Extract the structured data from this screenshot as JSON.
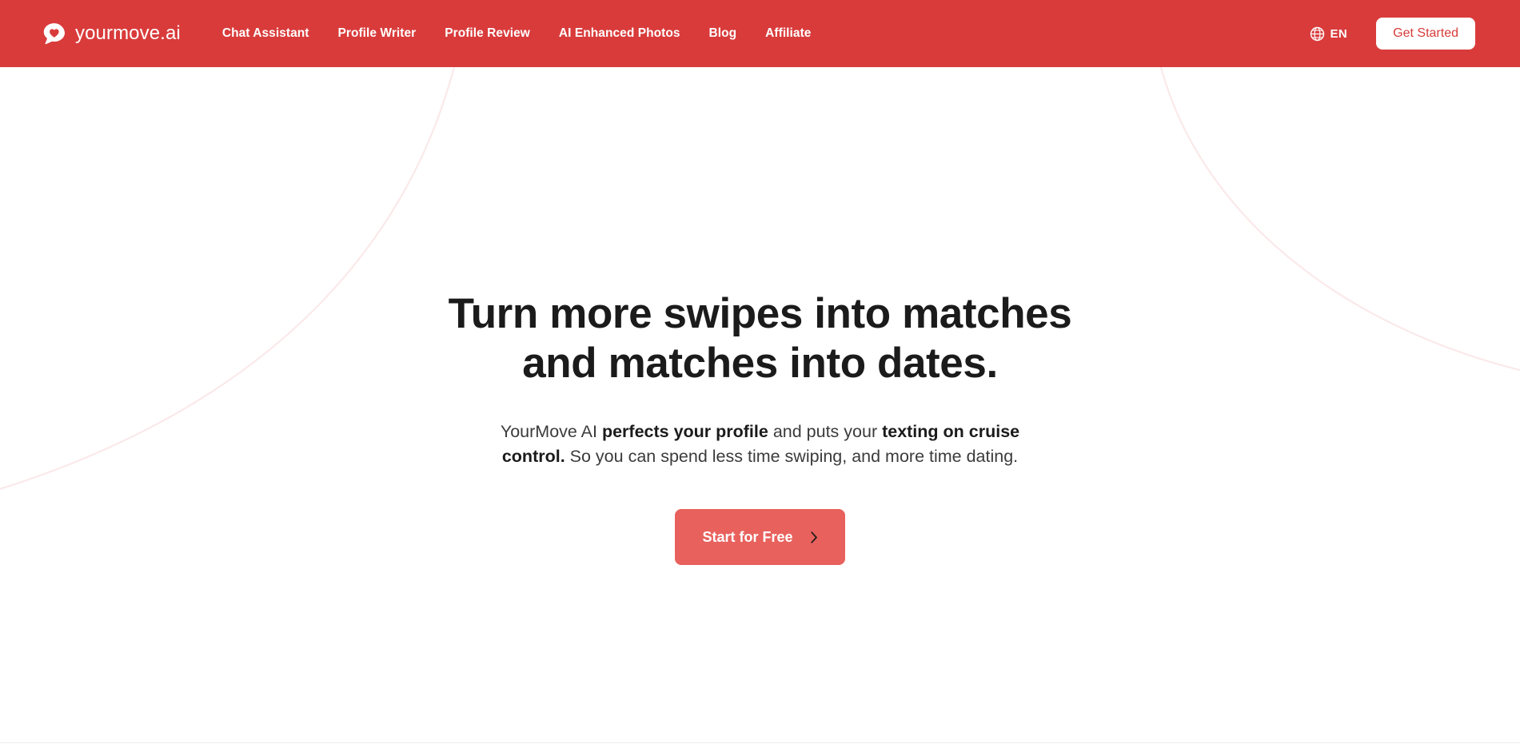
{
  "brand": {
    "name": "yourmove.ai",
    "logo_icon": "speech-bubble-heart-icon"
  },
  "colors": {
    "header_red": "#D93B3B",
    "cta_coral": "#E8615D",
    "button_text_red": "#D93B3B",
    "heading_black": "#1B1B1B",
    "body_gray": "#3B3B3B",
    "arc_pink": "#FBE9EA"
  },
  "nav": {
    "items": [
      {
        "label": "Chat Assistant"
      },
      {
        "label": "Profile Writer"
      },
      {
        "label": "Profile Review"
      },
      {
        "label": "AI Enhanced Photos"
      },
      {
        "label": "Blog"
      },
      {
        "label": "Affiliate"
      }
    ]
  },
  "header_actions": {
    "language": {
      "icon": "globe-icon",
      "code": "EN"
    },
    "get_started_label": "Get Started"
  },
  "hero": {
    "title_line_1": "Turn more swipes into matches",
    "title_line_2": "and matches into dates.",
    "subtitle": {
      "part_1": "YourMove AI ",
      "bold_1": "perfects your profile",
      "part_2": " and puts your ",
      "bold_2": "texting on cruise control.",
      "part_3": " So you can spend less time swiping, and more time dating."
    },
    "cta_label": "Start for Free",
    "cta_icon": "chevron-right-icon"
  }
}
